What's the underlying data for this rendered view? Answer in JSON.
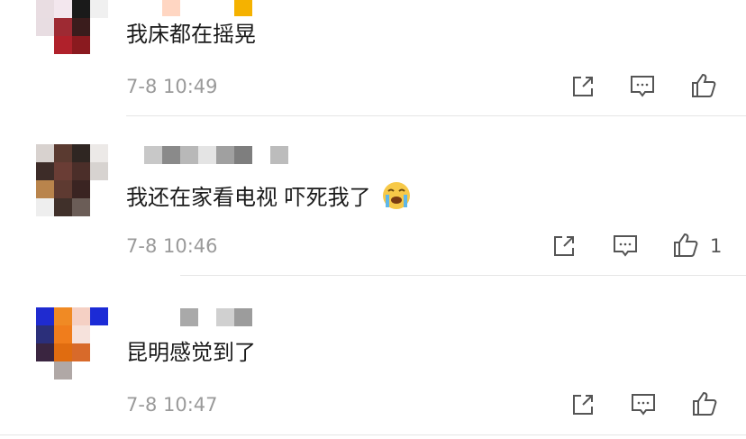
{
  "comments": [
    {
      "text": "我床都在摇晃",
      "time": "7-8 10:49",
      "like_count": ""
    },
    {
      "text": "我还在家看电视 吓死我了",
      "time": "7-8 10:46",
      "like_count": "1",
      "emoji": "scared-crying-emoji"
    },
    {
      "text": "昆明感觉到了",
      "time": "7-8 10:47",
      "like_count": ""
    }
  ],
  "icons": {
    "share": "share-icon",
    "reply": "comment-icon",
    "like": "thumbs-up-icon"
  },
  "colors": {
    "meta": "#9a9a9a",
    "text": "#1a1a1a",
    "icon": "#555555",
    "divider": "#e6e6e6"
  }
}
